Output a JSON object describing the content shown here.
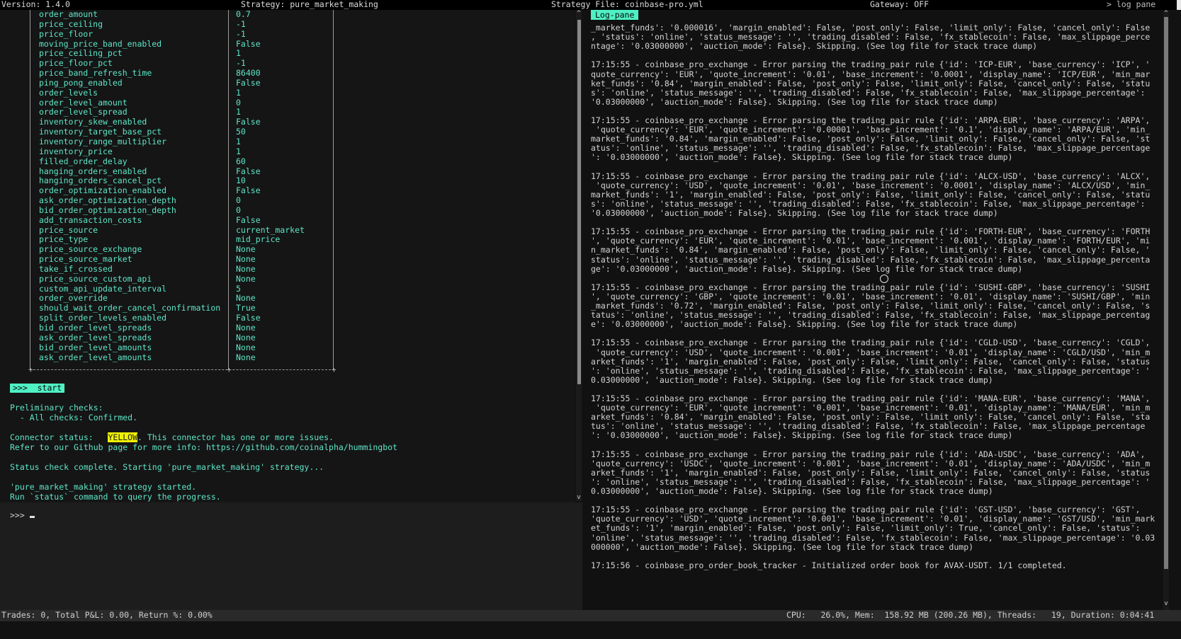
{
  "topbar": {
    "version": "Version: 1.4.0",
    "strategy": "Strategy: pure_market_making",
    "strategy_file": "Strategy File: coinbase-pro.yml",
    "gateway": "Gateway: OFF",
    "log_pane_toggle": "> log pane"
  },
  "config_table": {
    "rows": [
      {
        "key": "order_amount",
        "value": "0.7"
      },
      {
        "key": "price_ceiling",
        "value": "-1"
      },
      {
        "key": "price_floor",
        "value": "-1"
      },
      {
        "key": "moving_price_band_enabled",
        "value": "False"
      },
      {
        "key": "price_ceiling_pct",
        "value": "1"
      },
      {
        "key": "price_floor_pct",
        "value": "-1"
      },
      {
        "key": "price_band_refresh_time",
        "value": "86400"
      },
      {
        "key": "ping_pong_enabled",
        "value": "False"
      },
      {
        "key": "order_levels",
        "value": "1"
      },
      {
        "key": "order_level_amount",
        "value": "0"
      },
      {
        "key": "order_level_spread",
        "value": "1"
      },
      {
        "key": "inventory_skew_enabled",
        "value": "False"
      },
      {
        "key": "inventory_target_base_pct",
        "value": "50"
      },
      {
        "key": "inventory_range_multiplier",
        "value": "1"
      },
      {
        "key": "inventory_price",
        "value": "1"
      },
      {
        "key": "filled_order_delay",
        "value": "60"
      },
      {
        "key": "hanging_orders_enabled",
        "value": "False"
      },
      {
        "key": "hanging_orders_cancel_pct",
        "value": "10"
      },
      {
        "key": "order_optimization_enabled",
        "value": "False"
      },
      {
        "key": "ask_order_optimization_depth",
        "value": "0"
      },
      {
        "key": "bid_order_optimization_depth",
        "value": "0"
      },
      {
        "key": "add_transaction_costs",
        "value": "False"
      },
      {
        "key": "price_source",
        "value": "current_market"
      },
      {
        "key": "price_type",
        "value": "mid_price"
      },
      {
        "key": "price_source_exchange",
        "value": "None"
      },
      {
        "key": "price_source_market",
        "value": "None"
      },
      {
        "key": "take_if_crossed",
        "value": "None"
      },
      {
        "key": "price_source_custom_api",
        "value": "None"
      },
      {
        "key": "custom_api_update_interval",
        "value": "5"
      },
      {
        "key": "order_override",
        "value": "None"
      },
      {
        "key": "should_wait_order_cancel_confirmation",
        "value": "True"
      },
      {
        "key": "split_order_levels_enabled",
        "value": "False"
      },
      {
        "key": "bid_order_level_spreads",
        "value": "None"
      },
      {
        "key": "ask_order_level_spreads",
        "value": "None"
      },
      {
        "key": "bid_order_level_amounts",
        "value": "None"
      },
      {
        "key": "ask_order_level_amounts",
        "value": "None"
      }
    ]
  },
  "output": {
    "command_echo": ">>>  start",
    "preliminary_checks": "Preliminary checks:",
    "all_checks": "  - All checks: Confirmed.",
    "connector_status_label": "Connector status:   ",
    "connector_status_badge": "YELLOW",
    "connector_status_tail": ". This connector has one or more issues.",
    "refer_line": "Refer to our Github page for more info: https://github.com/coinalpha/hummingbot",
    "status_complete": "Status check complete. Starting 'pure_market_making' strategy...",
    "strategy_started": "'pure_market_making' strategy started.",
    "run_status": "Run `status` command to query the progress."
  },
  "input": {
    "prompt": ">>>"
  },
  "log_pane": {
    "title": "Log-pane",
    "lines": [
      "_market_funds': '0.000016', 'margin_enabled': False, 'post_only': False, 'limit_only': False, 'cancel_only': False",
      ", 'status': 'online', 'status_message': '', 'trading_disabled': False, 'fx_stablecoin': False, 'max_slippage_perce",
      "ntage': '0.03000000', 'auction_mode': False}. Skipping. (See log file for stack trace dump)",
      "",
      "17:15:55 - coinbase_pro_exchange - Error parsing the trading_pair rule {'id': 'ICP-EUR', 'base_currency': 'ICP', '",
      "quote_currency': 'EUR', 'quote_increment': '0.01', 'base_increment': '0.0001', 'display_name': 'ICP/EUR', 'min_mar",
      "ket_funds': '0.84', 'margin_enabled': False, 'post_only': False, 'limit_only': False, 'cancel_only': False, 'statu",
      "s': 'online', 'status_message': '', 'trading_disabled': False, 'fx_stablecoin': False, 'max_slippage_percentage':",
      "'0.03000000', 'auction_mode': False}. Skipping. (See log file for stack trace dump)",
      "",
      "17:15:55 - coinbase_pro_exchange - Error parsing the trading_pair rule {'id': 'ARPA-EUR', 'base_currency': 'ARPA',",
      " 'quote_currency': 'EUR', 'quote_increment': '0.00001', 'base_increment': '0.1', 'display_name': 'ARPA/EUR', 'min_",
      "market_funds': '0.84', 'margin_enabled': False, 'post_only': False, 'limit_only': False, 'cancel_only': False, 'st",
      "atus': 'online', 'status_message': '', 'trading_disabled': False, 'fx_stablecoin': False, 'max_slippage_percentage",
      "': '0.03000000', 'auction_mode': False}. Skipping. (See log file for stack trace dump)",
      "",
      "17:15:55 - coinbase_pro_exchange - Error parsing the trading_pair rule {'id': 'ALCX-USD', 'base_currency': 'ALCX',",
      " 'quote_currency': 'USD', 'quote_increment': '0.01', 'base_increment': '0.0001', 'display_name': 'ALCX/USD', 'min_",
      "market_funds': '1', 'margin_enabled': False, 'post_only': False, 'limit_only': False, 'cancel_only': False, 'statu",
      "s': 'online', 'status_message': '', 'trading_disabled': False, 'fx_stablecoin': False, 'max_slippage_percentage':",
      "'0.03000000', 'auction_mode': False}. Skipping. (See log file for stack trace dump)",
      "",
      "17:15:55 - coinbase_pro_exchange - Error parsing the trading_pair rule {'id': 'FORTH-EUR', 'base_currency': 'FORTH",
      "', 'quote_currency': 'EUR', 'quote_increment': '0.01', 'base_increment': '0.001', 'display_name': 'FORTH/EUR', 'mi",
      "n_market_funds': '0.84', 'margin_enabled': False, 'post_only': False, 'limit_only': False, 'cancel_only': False, '",
      "status': 'online', 'status_message': '', 'trading_disabled': False, 'fx_stablecoin': False, 'max_slippage_percenta",
      "ge': '0.03000000', 'auction_mode': False}. Skipping. (See log file for stack trace dump)",
      "",
      "17:15:55 - coinbase_pro_exchange - Error parsing the trading_pair rule {'id': 'SUSHI-GBP', 'base_currency': 'SUSHI",
      "', 'quote_currency': 'GBP', 'quote_increment': '0.01', 'base_increment': '0.01', 'display_name': 'SUSHI/GBP', 'min",
      "_market_funds': '0.72', 'margin_enabled': False, 'post_only': False, 'limit_only': False, 'cancel_only': False, 's",
      "tatus': 'online', 'status_message': '', 'trading_disabled': False, 'fx_stablecoin': False, 'max_slippage_percentag",
      "e': '0.03000000', 'auction_mode': False}. Skipping. (See log file for stack trace dump)",
      "",
      "17:15:55 - coinbase_pro_exchange - Error parsing the trading_pair rule {'id': 'CGLD-USD', 'base_currency': 'CGLD',",
      " 'quote_currency': 'USD', 'quote_increment': '0.001', 'base_increment': '0.01', 'display_name': 'CGLD/USD', 'min_m",
      "arket_funds': '1', 'margin_enabled': False, 'post_only': False, 'limit_only': False, 'cancel_only': False, 'status",
      "': 'online', 'status_message': '', 'trading_disabled': False, 'fx_stablecoin': False, 'max_slippage_percentage': '",
      "0.03000000', 'auction_mode': False}. Skipping. (See log file for stack trace dump)",
      "",
      "17:15:55 - coinbase_pro_exchange - Error parsing the trading_pair rule {'id': 'MANA-EUR', 'base_currency': 'MANA',",
      " 'quote_currency': 'EUR', 'quote_increment': '0.001', 'base_increment': '0.01', 'display_name': 'MANA/EUR', 'min_m",
      "arket_funds': '0.84', 'margin_enabled': False, 'post_only': False, 'limit_only': False, 'cancel_only': False, 'sta",
      "tus': 'online', 'status_message': '', 'trading_disabled': False, 'fx_stablecoin': False, 'max_slippage_percentage",
      "': '0.03000000', 'auction_mode': False}. Skipping. (See log file for stack trace dump)",
      "",
      "17:15:55 - coinbase_pro_exchange - Error parsing the trading_pair rule {'id': 'ADA-USDC', 'base_currency': 'ADA',",
      "'quote_currency': 'USDC', 'quote_increment': '0.001', 'base_increment': '0.01', 'display_name': 'ADA/USDC', 'min_m",
      "arket_funds': '1', 'margin_enabled': False, 'post_only': False, 'limit_only': False, 'cancel_only': False, 'status",
      "': 'online', 'status_message': '', 'trading_disabled': False, 'fx_stablecoin': False, 'max_slippage_percentage': '",
      "0.03000000', 'auction_mode': False}. Skipping. (See log file for stack trace dump)",
      "",
      "17:15:55 - coinbase_pro_exchange - Error parsing the trading_pair rule {'id': 'GST-USD', 'base_currency': 'GST',",
      "'quote_currency': 'USD', 'quote_increment': '0.001', 'base_increment': '0.01', 'display_name': 'GST/USD', 'min_mark",
      "et_funds': '1', 'margin_enabled': False, 'post_only': False, 'limit_only': True, 'cancel_only': False, 'status':",
      "'online', 'status_message': '', 'trading_disabled': False, 'fx_stablecoin': False, 'max_slippage_percentage': '0.03",
      "000000', 'auction_mode': False}. Skipping. (See log file for stack trace dump)",
      "",
      "17:15:56 - coinbase_pro_order_book_tracker - Initialized order book for AVAX-USDT. 1/1 completed."
    ]
  },
  "statusbar": {
    "trades": "Trades: 0, Total P&L: 0.00, Return %: 0.00%",
    "cpu": "CPU:   26.0%, Mem:  158.92 MB (200.26 MB), Threads:   19, Duration: 0:04:41"
  },
  "colors": {
    "accent": "#4ff0c4",
    "config_text": "#5ee6c8",
    "warning_badge": "#f2f200"
  }
}
